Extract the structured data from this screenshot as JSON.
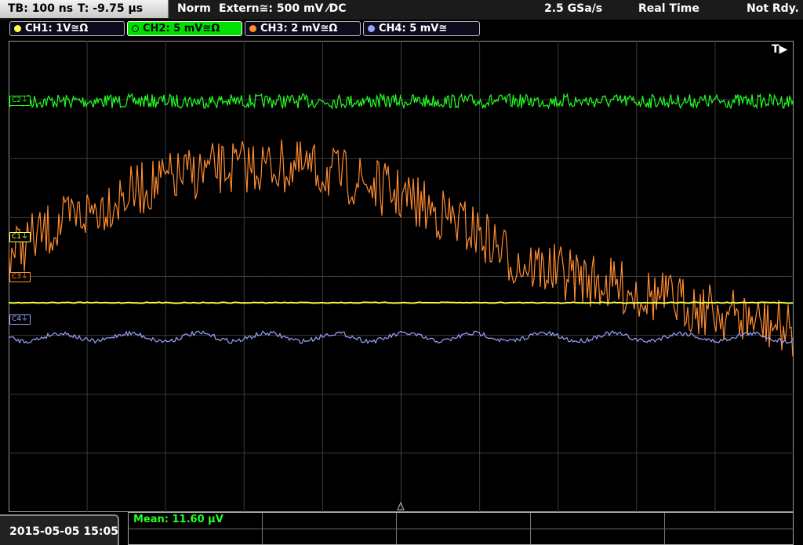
{
  "status": {
    "timebase": "TB: 100 ns",
    "trigger_time": "T: -9.75 µs",
    "mode": "Norm",
    "trigger_source": "Extern≅: 500 mV ⁄DC",
    "sample_rate": "2.5 GSa/s",
    "acquisition": "Real Time",
    "state": "Not Rdy."
  },
  "channels": [
    {
      "label": "CH1: 1V≅Ω",
      "color": "#ffff40"
    },
    {
      "label": "CH2: 5 mV≅Ω",
      "color": "#22ff22"
    },
    {
      "label": "CH3: 2 mV≅Ω",
      "color": "#ff8c30"
    },
    {
      "label": "CH4: 5 mV≅",
      "color": "#9aa2ff"
    }
  ],
  "markers": {
    "c1": "C1⏚",
    "c2": "C2⏚",
    "c3": "C3⏚",
    "c4": "C4⏚",
    "trigger": "T▶"
  },
  "datetime": "2015-05-05 15:05",
  "measurement": "Mean: 11.60 µV",
  "icons": {
    "trigger_position": "triangle-up-icon"
  }
}
